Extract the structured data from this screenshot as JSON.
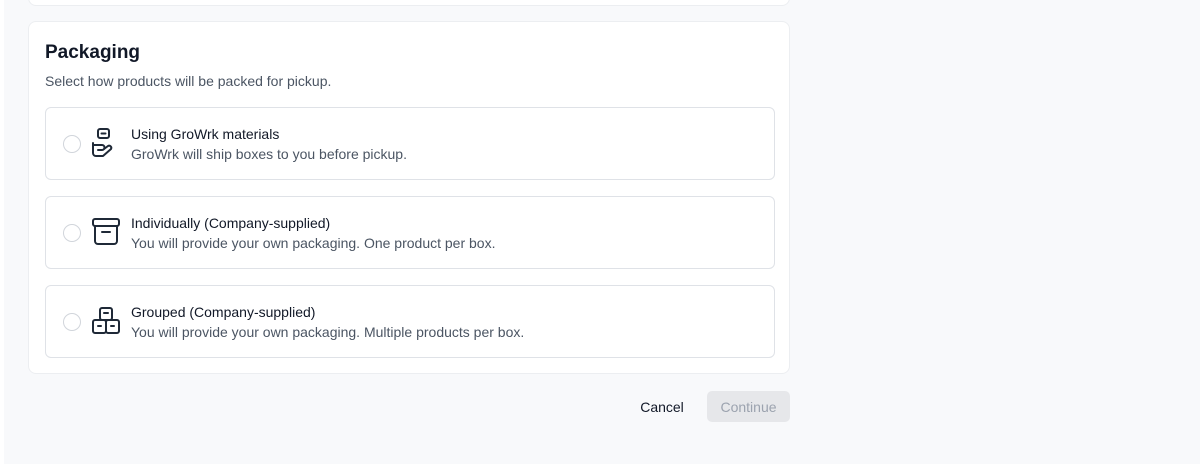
{
  "section": {
    "title": "Packaging",
    "subtitle": "Select how products will be packed for pickup."
  },
  "options": [
    {
      "title": "Using GroWrk materials",
      "description": "GroWrk will ship boxes to you before pickup.",
      "icon": "hand-box-icon",
      "selected": false
    },
    {
      "title": "Individually (Company-supplied)",
      "description": "You will provide your own packaging. One product per box.",
      "icon": "archive-box-icon",
      "selected": false
    },
    {
      "title": "Grouped (Company-supplied)",
      "description": "You will provide your own packaging. Multiple products per box.",
      "icon": "boxes-stack-icon",
      "selected": false
    }
  ],
  "actions": {
    "cancel_label": "Cancel",
    "continue_label": "Continue",
    "continue_disabled": true
  },
  "colors": {
    "text_primary": "#111827",
    "text_secondary": "#4b5563",
    "border": "#dfe2e7",
    "disabled_bg": "#e6e7ea",
    "disabled_text": "#9ca3af"
  }
}
